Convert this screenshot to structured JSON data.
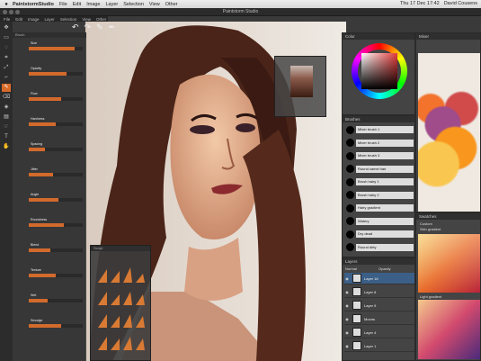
{
  "menubar": {
    "apple": "",
    "app": "PaintstormStudio",
    "items": [
      "File",
      "Edit",
      "Image",
      "Layer",
      "Selection",
      "View",
      "Other"
    ],
    "clock": "Thu 17 Dec 17:42",
    "user": "David Cousens"
  },
  "window": {
    "title": "Paintstorm Studio"
  },
  "appmenu": {
    "items": [
      "File",
      "Edit",
      "Image",
      "Layer",
      "Selection",
      "View",
      "Other"
    ]
  },
  "toolbar": {
    "undo": "↶",
    "redo": "↷"
  },
  "panels": {
    "brush": "Brush",
    "color": "Color",
    "brushes": "Brushes",
    "mixer": "Mixer",
    "layers": "Layers",
    "swatches": "Swatches",
    "script": "Script"
  },
  "brush_settings": [
    {
      "label": "Size",
      "value": 0.85
    },
    {
      "label": "Opacity",
      "value": 0.7
    },
    {
      "label": "Flow",
      "value": 0.6
    },
    {
      "label": "Hardness",
      "value": 0.5
    },
    {
      "label": "Spacing",
      "value": 0.3
    },
    {
      "label": "Jitter",
      "value": 0.45
    },
    {
      "label": "Angle",
      "value": 0.55
    },
    {
      "label": "Roundness",
      "value": 0.65
    },
    {
      "label": "Blend",
      "value": 0.4
    },
    {
      "label": "Texture",
      "value": 0.5
    },
    {
      "label": "Wet",
      "value": 0.35
    },
    {
      "label": "Smudge",
      "value": 0.6
    }
  ],
  "brushes": [
    "Mixer brush 1",
    "Mixer brush 2",
    "Mixer brush 3",
    "Round camel hair",
    "Brush hairy 1",
    "Brush hairy 2",
    "Hairy gradient",
    "Watery",
    "Dry dead",
    "Round dirty"
  ],
  "layers": {
    "mode": "Normal",
    "opacity_label": "Opacity",
    "items": [
      {
        "name": "Layer 16",
        "selected": true
      },
      {
        "name": "Layer 8"
      },
      {
        "name": "Layer 5"
      },
      {
        "name": "Moons"
      },
      {
        "name": "Layer 4"
      },
      {
        "name": "Layer 1"
      }
    ]
  },
  "swatches": {
    "groups": [
      "Custom",
      "Skin gradient",
      "Light gradient"
    ]
  },
  "colors": {
    "accent": "#d96b2a",
    "selection": "#3b5f86"
  }
}
